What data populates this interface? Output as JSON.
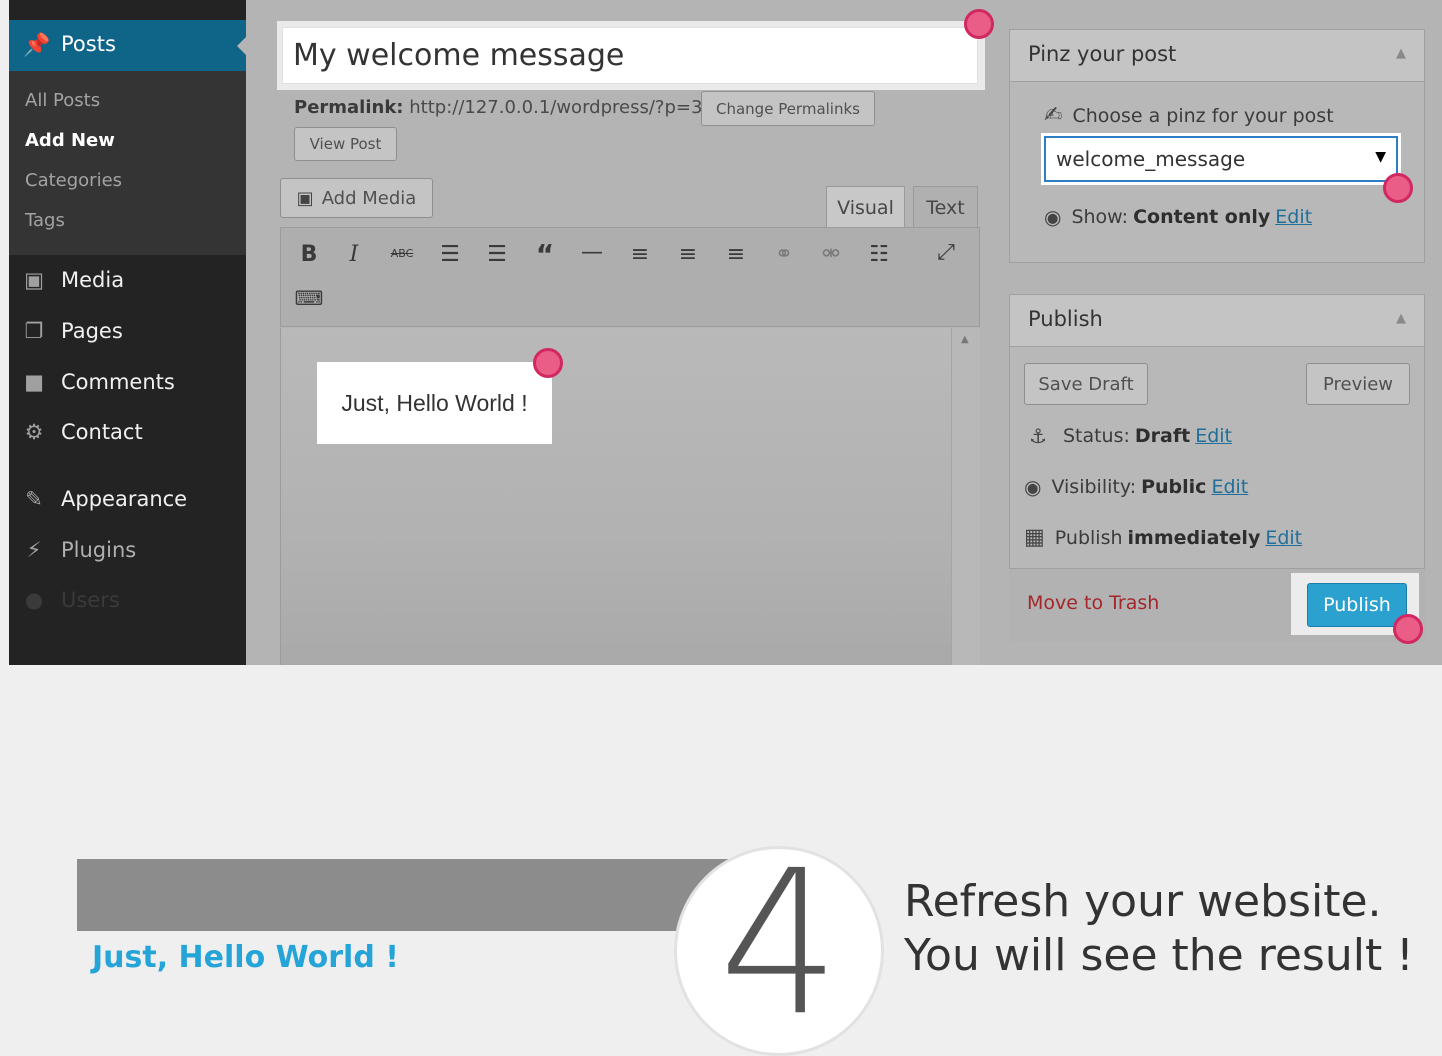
{
  "sidebar": {
    "active_label": "Posts",
    "submenu": [
      "All Posts",
      "Add New",
      "Categories",
      "Tags"
    ],
    "items": [
      {
        "label": "Media",
        "icon": "media-icon"
      },
      {
        "label": "Pages",
        "icon": "pages-icon"
      },
      {
        "label": "Comments",
        "icon": "comment-icon"
      },
      {
        "label": "Contact",
        "icon": "gear-icon"
      },
      {
        "label": "Appearance",
        "icon": "paintbrush-icon"
      },
      {
        "label": "Plugins",
        "icon": "plug-icon"
      },
      {
        "label": "Users",
        "icon": "user-icon"
      }
    ]
  },
  "editor": {
    "title": "My welcome message",
    "permalink_label": "Permalink:",
    "permalink_url": "http://127.0.0.1/wordpress/?p=34",
    "change_permalinks": "Change Permalinks",
    "view_post": "View Post",
    "add_media": "Add Media",
    "tab_visual": "Visual",
    "tab_text": "Text",
    "content": "Just, Hello World !"
  },
  "pinz_panel": {
    "title": "Pinz your post",
    "choose_label": "Choose a pinz for your post",
    "selected": "welcome_message",
    "show_label": "Show:",
    "show_value": "Content only",
    "edit": "Edit"
  },
  "publish_panel": {
    "title": "Publish",
    "save_draft": "Save Draft",
    "preview": "Preview",
    "status_label": "Status:",
    "status_value": "Draft",
    "visibility_label": "Visibility:",
    "visibility_value": "Public",
    "publish_label": "Publish",
    "publish_value": "immediately",
    "edit": "Edit",
    "move_to_trash": "Move to Trash",
    "publish_button": "Publish"
  },
  "step": {
    "number": "4",
    "line1": "Refresh your website.",
    "line2": "You will see the result !",
    "preview_title": "Just, Hello World !"
  },
  "colors": {
    "accent": "#2ba1d0",
    "marker": "#ea5d86",
    "sidebar_active": "#0f6588"
  }
}
